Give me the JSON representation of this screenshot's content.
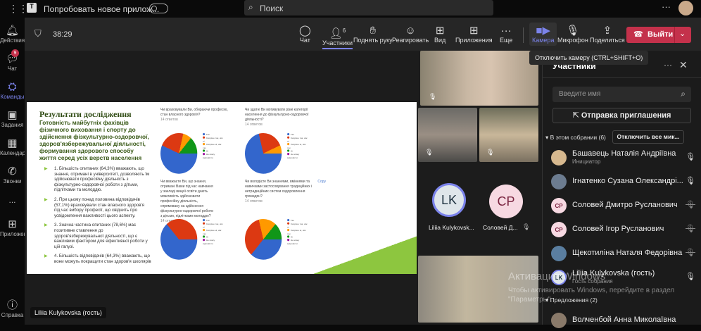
{
  "topbar": {
    "promo": "Попробовать новое прилож...",
    "search_placeholder": "Поиск"
  },
  "rail": [
    {
      "label": "Действия",
      "icon": "bell"
    },
    {
      "label": "Чат",
      "icon": "chat",
      "badge": "9"
    },
    {
      "label": "Команды",
      "icon": "teams"
    },
    {
      "label": "Задания",
      "icon": "backpack"
    },
    {
      "label": "Календарь",
      "icon": "calendar"
    },
    {
      "label": "Звонки",
      "icon": "phone"
    },
    {
      "label": "...",
      "icon": "more"
    },
    {
      "label": "Приложен...",
      "icon": "apps"
    },
    {
      "label": "Справка",
      "icon": "help"
    }
  ],
  "meeting": {
    "timer": "38:29",
    "buttons": {
      "chat": "Чат",
      "participants": "Участники",
      "participants_count": "6",
      "raise": "Поднять руку",
      "react": "Реагировать",
      "view": "Вид",
      "apps": "Приложения",
      "more": "Еще",
      "camera": "Камера",
      "mic": "Микрофон",
      "share": "Поделиться",
      "leave": "Выйти"
    },
    "tooltip": "Отключить камеру (CTRL+SHIFT+O)"
  },
  "colors": {
    "accent": "#7b83eb",
    "leave": "#c4314b",
    "slide_green": "#8dc63f"
  },
  "slide": {
    "title": "Результати дослідження",
    "subtitle": "Готовність майбутніх фахівців фізичного виховання і спорту до здійснення фізкультурно-оздоровчої, здоров'язбережувальної діяльності, формування здорового способу життя серед усіх верств населення",
    "bullets": [
      "1. Більшість опитаних (64,3%) вважають, що знання, отримані в університеті, дозволяють їм здійснювати професійну діяльність з фізкультурно-оздоровчої роботи з дітьми, підлітками та молоддю.",
      "2. При цьому понад половина відповідачів (57,1%) враховували стан власного здоров'я під час вибору професії, що свідчить про усвідомлення важливості цього аспекту.",
      "3. Значна частина опитаних (78,6%) має позитивне ставлення до здоров'язбережувальної діяльності, що є важливим фактором для ефективної роботи у цій галузі.",
      "4. Більшість відповідачів (64,3%) вважають, що вони можуть покращити стан здоров'я школярів"
    ],
    "legend": [
      "Так",
      "Скоріше так, ніж ні",
      "Скоріше ні, ніж так",
      "Ні",
      "Не можу відповісти"
    ],
    "legend_colors": [
      "#3366cc",
      "#dc3912",
      "#ff9900",
      "#109618",
      "#990099"
    ],
    "charts": [
      {
        "question": "Чи враховували Ви, обираючи професію, стан власного здоров'я?",
        "responses": "14 ответов",
        "values": [
          57.1,
          21.4,
          7.1,
          14.3,
          0
        ]
      },
      {
        "question": "Чи здатні Ви мотивувати різні категорії населення до фізкультурно-оздоровчої діяльності?",
        "responses": "14 ответов",
        "values": [
          71.4,
          21.4,
          7.1,
          0,
          0
        ]
      },
      {
        "question": "Чи вважаєте Ви, що знання, отримані Вами під час навчання у закладі вищої освіти дають можливість здійснювати професійну діяльність, спрямовану на здійснення фізкультурно-оздоровчої роботи з дітьми, підлітками молоддю?",
        "responses": "14 ответов",
        "values": [
          64.3,
          35.7,
          0,
          0,
          0
        ]
      },
      {
        "question": "Чи володієте Ви знаннями, вміннями та навичками застосовування традиційних і нетрадиційних систем оздоровлення громадян?",
        "responses": "14 ответов",
        "values": [
          35.7,
          35.7,
          14.3,
          14.3,
          0
        ],
        "copy": "Copy"
      }
    ]
  },
  "tiles": {
    "lk_initials": "LK",
    "lk_name": "Liliia Kulykovsk...",
    "cp_initials": "CP",
    "cp_name": "Соловей Д...",
    "presenter_label": "Liliia Kulykovska (гость)"
  },
  "panel": {
    "title": "Участники",
    "search_placeholder": "Введите имя",
    "invite": "Отправка приглашения",
    "in_meeting": "В этом собрании (6)",
    "mute_all": "Отключить все мик...",
    "suggestions": "Предложения (2)",
    "people": [
      {
        "name": "Башавець Наталія Андріївна",
        "role": "Инициатор",
        "mic": "on"
      },
      {
        "name": "Ігнатенко Сузана Олександрі...",
        "role": "",
        "mic": "on"
      },
      {
        "name": "Соловей Дмитро Русланович",
        "role": "",
        "mic": "off",
        "initials": "CP"
      },
      {
        "name": "Соловей Ігор Русланович",
        "role": "",
        "mic": "off",
        "initials": "CP"
      },
      {
        "name": "Щекотиліна Наталя Федорівна",
        "role": "",
        "mic": "off"
      },
      {
        "name": "Liliia Kulykovska (гость)",
        "role": "Гость собрания",
        "mic": "on",
        "initials": "LK"
      }
    ],
    "suggested": [
      {
        "name": "Волченбой Анна Миколаївна"
      }
    ]
  },
  "watermark": {
    "title": "Активация Windows",
    "text": "Чтобы активировать Windows, перейдите в раздел \"Параметры\"."
  }
}
